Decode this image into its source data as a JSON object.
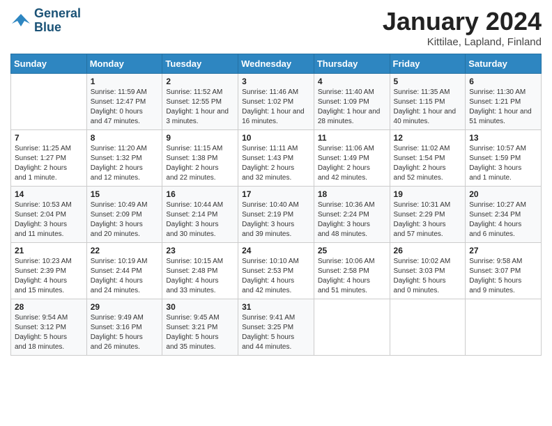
{
  "header": {
    "logo_line1": "General",
    "logo_line2": "Blue",
    "month_year": "January 2024",
    "location": "Kittilae, Lapland, Finland"
  },
  "days_of_week": [
    "Sunday",
    "Monday",
    "Tuesday",
    "Wednesday",
    "Thursday",
    "Friday",
    "Saturday"
  ],
  "weeks": [
    [
      {
        "day": "",
        "info": ""
      },
      {
        "day": "1",
        "info": "Sunrise: 11:59 AM\nSunset: 12:47 PM\nDaylight: 0 hours\nand 47 minutes."
      },
      {
        "day": "2",
        "info": "Sunrise: 11:52 AM\nSunset: 12:55 PM\nDaylight: 1 hour and\n3 minutes."
      },
      {
        "day": "3",
        "info": "Sunrise: 11:46 AM\nSunset: 1:02 PM\nDaylight: 1 hour and\n16 minutes."
      },
      {
        "day": "4",
        "info": "Sunrise: 11:40 AM\nSunset: 1:09 PM\nDaylight: 1 hour and\n28 minutes."
      },
      {
        "day": "5",
        "info": "Sunrise: 11:35 AM\nSunset: 1:15 PM\nDaylight: 1 hour and\n40 minutes."
      },
      {
        "day": "6",
        "info": "Sunrise: 11:30 AM\nSunset: 1:21 PM\nDaylight: 1 hour and\n51 minutes."
      }
    ],
    [
      {
        "day": "7",
        "info": "Sunrise: 11:25 AM\nSunset: 1:27 PM\nDaylight: 2 hours\nand 1 minute."
      },
      {
        "day": "8",
        "info": "Sunrise: 11:20 AM\nSunset: 1:32 PM\nDaylight: 2 hours\nand 12 minutes."
      },
      {
        "day": "9",
        "info": "Sunrise: 11:15 AM\nSunset: 1:38 PM\nDaylight: 2 hours\nand 22 minutes."
      },
      {
        "day": "10",
        "info": "Sunrise: 11:11 AM\nSunset: 1:43 PM\nDaylight: 2 hours\nand 32 minutes."
      },
      {
        "day": "11",
        "info": "Sunrise: 11:06 AM\nSunset: 1:49 PM\nDaylight: 2 hours\nand 42 minutes."
      },
      {
        "day": "12",
        "info": "Sunrise: 11:02 AM\nSunset: 1:54 PM\nDaylight: 2 hours\nand 52 minutes."
      },
      {
        "day": "13",
        "info": "Sunrise: 10:57 AM\nSunset: 1:59 PM\nDaylight: 3 hours\nand 1 minute."
      }
    ],
    [
      {
        "day": "14",
        "info": "Sunrise: 10:53 AM\nSunset: 2:04 PM\nDaylight: 3 hours\nand 11 minutes."
      },
      {
        "day": "15",
        "info": "Sunrise: 10:49 AM\nSunset: 2:09 PM\nDaylight: 3 hours\nand 20 minutes."
      },
      {
        "day": "16",
        "info": "Sunrise: 10:44 AM\nSunset: 2:14 PM\nDaylight: 3 hours\nand 30 minutes."
      },
      {
        "day": "17",
        "info": "Sunrise: 10:40 AM\nSunset: 2:19 PM\nDaylight: 3 hours\nand 39 minutes."
      },
      {
        "day": "18",
        "info": "Sunrise: 10:36 AM\nSunset: 2:24 PM\nDaylight: 3 hours\nand 48 minutes."
      },
      {
        "day": "19",
        "info": "Sunrise: 10:31 AM\nSunset: 2:29 PM\nDaylight: 3 hours\nand 57 minutes."
      },
      {
        "day": "20",
        "info": "Sunrise: 10:27 AM\nSunset: 2:34 PM\nDaylight: 4 hours\nand 6 minutes."
      }
    ],
    [
      {
        "day": "21",
        "info": "Sunrise: 10:23 AM\nSunset: 2:39 PM\nDaylight: 4 hours\nand 15 minutes."
      },
      {
        "day": "22",
        "info": "Sunrise: 10:19 AM\nSunset: 2:44 PM\nDaylight: 4 hours\nand 24 minutes."
      },
      {
        "day": "23",
        "info": "Sunrise: 10:15 AM\nSunset: 2:48 PM\nDaylight: 4 hours\nand 33 minutes."
      },
      {
        "day": "24",
        "info": "Sunrise: 10:10 AM\nSunset: 2:53 PM\nDaylight: 4 hours\nand 42 minutes."
      },
      {
        "day": "25",
        "info": "Sunrise: 10:06 AM\nSunset: 2:58 PM\nDaylight: 4 hours\nand 51 minutes."
      },
      {
        "day": "26",
        "info": "Sunrise: 10:02 AM\nSunset: 3:03 PM\nDaylight: 5 hours\nand 0 minutes."
      },
      {
        "day": "27",
        "info": "Sunrise: 9:58 AM\nSunset: 3:07 PM\nDaylight: 5 hours\nand 9 minutes."
      }
    ],
    [
      {
        "day": "28",
        "info": "Sunrise: 9:54 AM\nSunset: 3:12 PM\nDaylight: 5 hours\nand 18 minutes."
      },
      {
        "day": "29",
        "info": "Sunrise: 9:49 AM\nSunset: 3:16 PM\nDaylight: 5 hours\nand 26 minutes."
      },
      {
        "day": "30",
        "info": "Sunrise: 9:45 AM\nSunset: 3:21 PM\nDaylight: 5 hours\nand 35 minutes."
      },
      {
        "day": "31",
        "info": "Sunrise: 9:41 AM\nSunset: 3:25 PM\nDaylight: 5 hours\nand 44 minutes."
      },
      {
        "day": "",
        "info": ""
      },
      {
        "day": "",
        "info": ""
      },
      {
        "day": "",
        "info": ""
      }
    ]
  ]
}
